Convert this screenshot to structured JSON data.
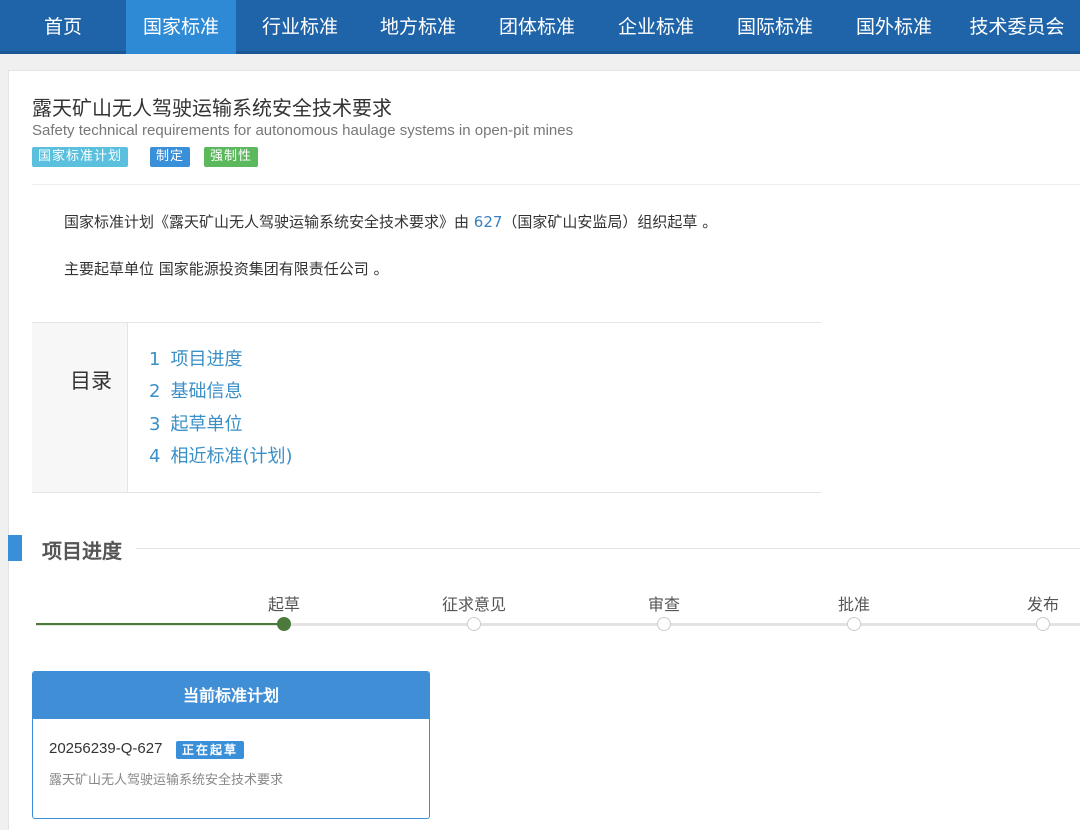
{
  "nav": {
    "items": [
      "首页",
      "国家标准",
      "行业标准",
      "地方标准",
      "团体标准",
      "企业标准",
      "国际标准",
      "国外标准",
      "技术委员会"
    ],
    "active_index": 1
  },
  "standard": {
    "title_cn": "露天矿山无人驾驶运输系统安全技术要求",
    "title_en": "Safety technical requirements for autonomous haulage systems in open-pit mines",
    "tags": {
      "plan": "国家标准计划",
      "type": "制定",
      "force": "强制性"
    }
  },
  "description": {
    "line1_prefix": "国家标准计划《露天矿山无人驾驶运输系统安全技术要求》由 ",
    "line1_link": "627",
    "line1_suffix": "（国家矿山安监局）组织起草 。",
    "line2": "主要起草单位 国家能源投资集团有限责任公司 。"
  },
  "toc": {
    "title": "目录",
    "items": [
      {
        "num": "1",
        "label": "项目进度"
      },
      {
        "num": "2",
        "label": "基础信息"
      },
      {
        "num": "3",
        "label": "起草单位"
      },
      {
        "num": "4",
        "label": "相近标准(计划)"
      }
    ]
  },
  "progress": {
    "section_title": "项目进度",
    "stages": [
      "起草",
      "征求意见",
      "审查",
      "批准",
      "发布"
    ],
    "completed_count": 1
  },
  "current_plan": {
    "header": "当前标准计划",
    "plan_number": "20256239-Q-627",
    "status": "正在起草",
    "name": "露天矿山无人驾驶运输系统安全技术要求"
  },
  "colors": {
    "nav_bg": "#1f64a8",
    "nav_active": "#2f8ad6",
    "link": "#3a8fc6",
    "progress_done": "#4c7a3c",
    "accent": "#3a8fd9"
  }
}
